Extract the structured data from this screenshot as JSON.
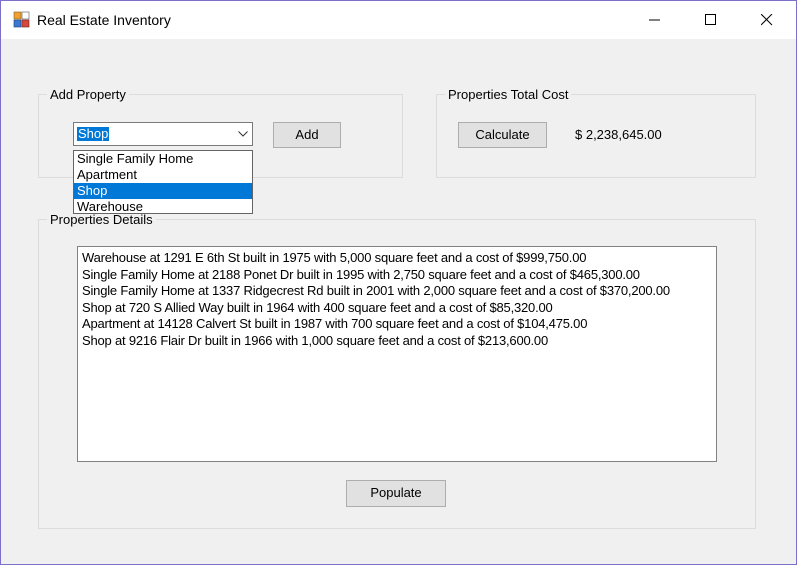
{
  "window": {
    "title": "Real Estate Inventory"
  },
  "add_group": {
    "title": "Add Property",
    "combo_value": "Shop",
    "options": [
      "Single Family Home",
      "Apartment",
      "Shop",
      "Warehouse"
    ],
    "selected_index": 2,
    "add_label": "Add"
  },
  "total_group": {
    "title": "Properties Total Cost",
    "calculate_label": "Calculate",
    "total_value": "$ 2,238,645.00"
  },
  "details_group": {
    "title": "Properties Details",
    "lines": [
      "Warehouse at 1291 E 6th St built in 1975 with 5,000 square feet and a cost of $999,750.00",
      "Single Family Home at 2188 Ponet Dr built in 1995 with 2,750 square feet and a cost of $465,300.00",
      "Single Family Home at 1337 Ridgecrest Rd built in 2001 with 2,000 square feet and a cost of $370,200.00",
      "Shop at 720 S Allied Way built in 1964 with 400 square feet and a cost of $85,320.00",
      "Apartment at 14128 Calvert St built in 1987 with 700 square feet and a cost of $104,475.00",
      "Shop at 9216 Flair Dr built in 1966 with 1,000 square feet and a cost of $213,600.00"
    ],
    "populate_label": "Populate"
  },
  "colors": {
    "selection": "#0078d7",
    "window_bg": "#f0f0f0",
    "border": "#7a6fc9"
  }
}
